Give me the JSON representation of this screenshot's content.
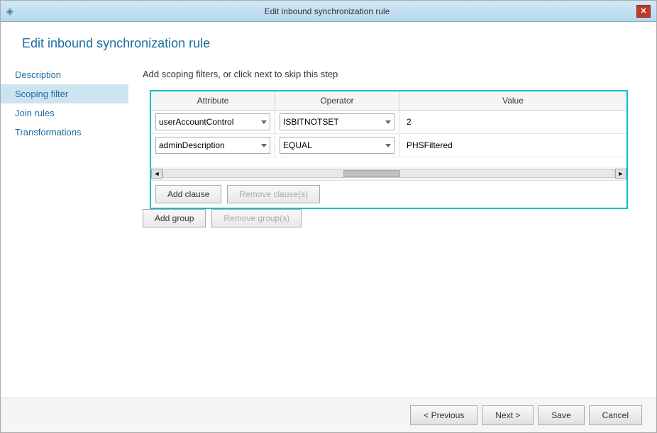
{
  "window": {
    "title": "Edit inbound synchronization rule",
    "close_label": "✕"
  },
  "page_title": "Edit inbound synchronization rule",
  "step_description": "Add scoping filters, or click next to skip this step",
  "sidebar": {
    "items": [
      {
        "id": "description",
        "label": "Description",
        "active": false
      },
      {
        "id": "scoping-filter",
        "label": "Scoping filter",
        "active": true
      },
      {
        "id": "join-rules",
        "label": "Join rules",
        "active": false
      },
      {
        "id": "transformations",
        "label": "Transformations",
        "active": false
      }
    ]
  },
  "table": {
    "columns": [
      "Attribute",
      "Operator",
      "Value"
    ],
    "rows": [
      {
        "attribute": "userAccountControl",
        "operator": "ISBITNOTSET",
        "value": "2"
      },
      {
        "attribute": "adminDescription",
        "operator": "EQUAL",
        "value": "PHSFiltered"
      }
    ]
  },
  "buttons": {
    "add_clause": "Add clause",
    "remove_clause": "Remove clause(s)",
    "add_group": "Add group",
    "remove_group": "Remove group(s)"
  },
  "footer": {
    "previous": "< Previous",
    "next": "Next >",
    "save": "Save",
    "cancel": "Cancel"
  },
  "icons": {
    "window_icon": "◈",
    "scroll_left": "◄",
    "scroll_right": "►"
  }
}
